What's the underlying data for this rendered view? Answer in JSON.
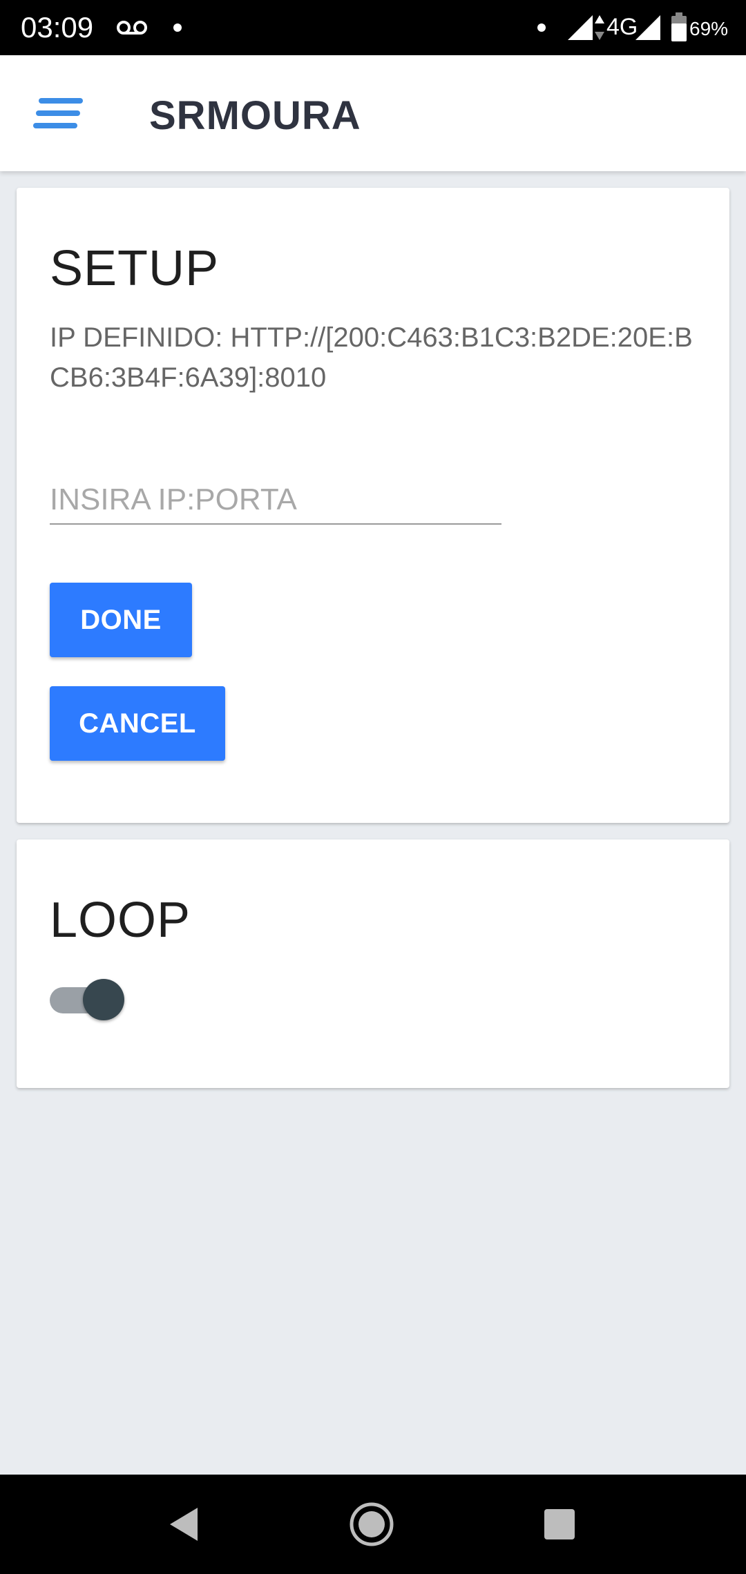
{
  "status_bar": {
    "time": "03:09",
    "network": "4G",
    "battery": "69%",
    "icons": [
      "voicemail-icon",
      "notification-dot-icon",
      "signal-icon",
      "data-arrows-icon",
      "battery-icon"
    ]
  },
  "app_bar": {
    "title": "SRMOURA",
    "menu_icon": "hamburger-menu-icon",
    "accent_color": "#3c8de6"
  },
  "setup_card": {
    "title": "SETUP",
    "ip_defined": "IP DEFINIDO: HTTP://[200:C463:B1C3:B2DE:20E:BCB6:3B4F:6A39]:8010",
    "input": {
      "value": "",
      "placeholder": "INSIRA IP:PORTA"
    },
    "done_label": "DONE",
    "cancel_label": "CANCEL",
    "button_color": "#2d7bff"
  },
  "loop_card": {
    "title": "LOOP",
    "toggle_on": true
  },
  "nav_bar": {
    "icons": [
      "back-icon",
      "home-icon",
      "recents-icon"
    ]
  }
}
